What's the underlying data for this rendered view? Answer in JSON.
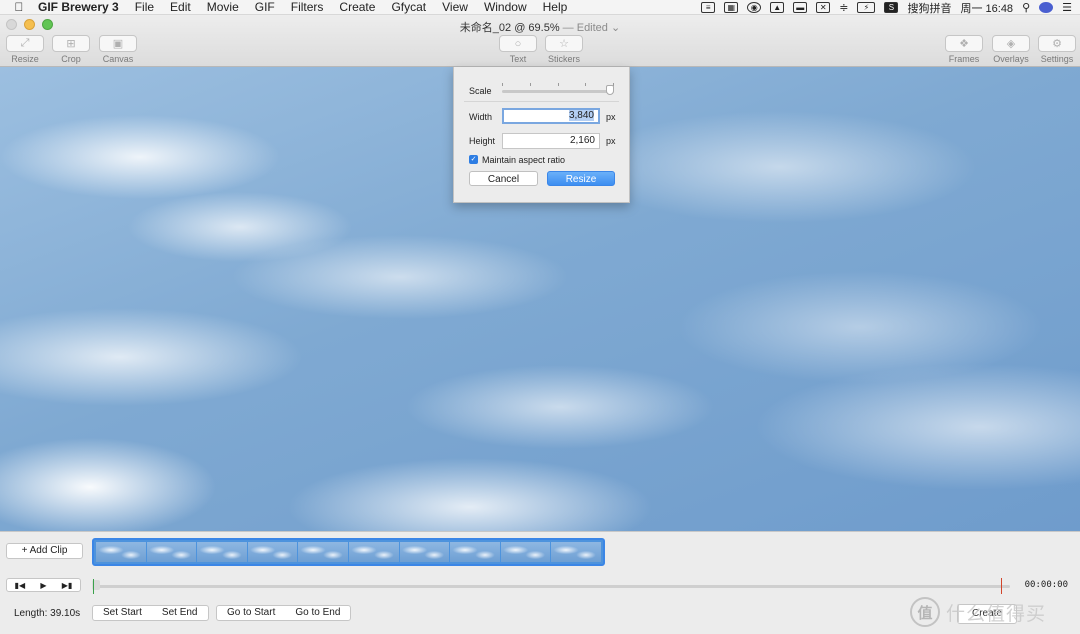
{
  "menubar": {
    "apple_icon": "apple-logo",
    "items": [
      "GIF Brewery 3",
      "File",
      "Edit",
      "Movie",
      "GIF",
      "Filters",
      "Create",
      "Gfycat",
      "View",
      "Window",
      "Help"
    ],
    "status": {
      "input_method": "搜狗拼音",
      "clock": "周一 16:48",
      "icons": [
        "document-icon",
        "tiles-icon",
        "eye-icon",
        "photo-icon",
        "keyboard-icon",
        "x-icon",
        "wifi-icon",
        "battery-icon",
        "sogou-icon",
        "search-icon",
        "siri-icon",
        "menu-list-icon"
      ]
    }
  },
  "window": {
    "title": "未命名_02 @ 69.5%",
    "edited": "— Edited"
  },
  "toolbar": {
    "resize": "Resize",
    "crop": "Crop",
    "canvas": "Canvas",
    "text": "Text",
    "stickers": "Stickers",
    "frames": "Frames",
    "overlays": "Overlays",
    "settings": "Settings"
  },
  "resize_popover": {
    "scale_label": "Scale",
    "scale_value": 1.0,
    "width_label": "Width",
    "width_value": "3,840",
    "height_label": "Height",
    "height_value": "2,160",
    "unit": "px",
    "maintain_aspect": "Maintain aspect ratio",
    "maintain_aspect_checked": true,
    "cancel": "Cancel",
    "resize": "Resize"
  },
  "timeline": {
    "add_clip": "+ Add Clip",
    "frames": 10,
    "timecode": "00:00:00",
    "length": "Length: 39.10s",
    "set_start": "Set Start",
    "set_end": "Set End",
    "go_to_start": "Go to Start",
    "go_to_end": "Go to End",
    "create": "Create"
  },
  "watermark": {
    "text": "什么值得买",
    "mark": "值"
  },
  "colors": {
    "accent": "#3d8ef1",
    "start_marker": "#3aa14b",
    "end_marker": "#d2452b"
  }
}
